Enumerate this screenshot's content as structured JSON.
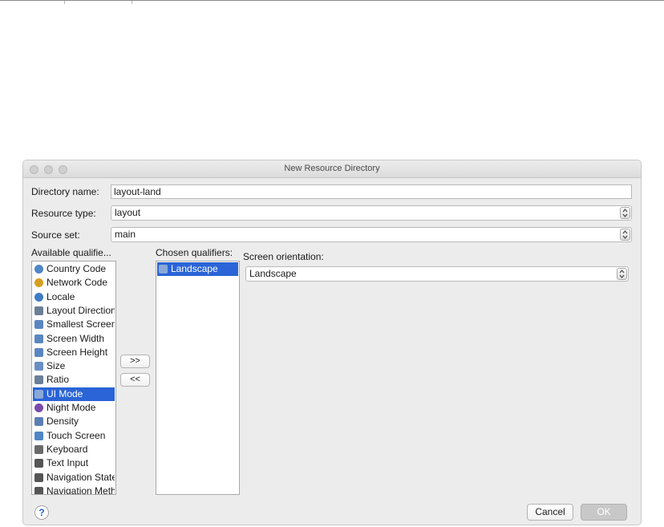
{
  "window": {
    "title": "New Resource Directory"
  },
  "form": {
    "directory_name_label": "Directory name:",
    "directory_name_value": "layout-land",
    "resource_type_label": "Resource type:",
    "resource_type_value": "layout",
    "source_set_label": "Source set:",
    "source_set_value": "main"
  },
  "available": {
    "label": "Available qualifie...",
    "items": [
      {
        "label": "Country Code",
        "icon": "globe-icon"
      },
      {
        "label": "Network Code",
        "icon": "network-icon"
      },
      {
        "label": "Locale",
        "icon": "locale-icon"
      },
      {
        "label": "Layout Direction",
        "icon": "layout-direction-icon"
      },
      {
        "label": "Smallest Screen",
        "icon": "smallest-screen-icon"
      },
      {
        "label": "Screen Width",
        "icon": "screen-width-icon"
      },
      {
        "label": "Screen Height",
        "icon": "screen-height-icon"
      },
      {
        "label": "Size",
        "icon": "size-icon"
      },
      {
        "label": "Ratio",
        "icon": "ratio-icon"
      },
      {
        "label": "UI Mode",
        "icon": "ui-mode-icon",
        "selected": true
      },
      {
        "label": "Night Mode",
        "icon": "night-mode-icon"
      },
      {
        "label": "Density",
        "icon": "density-icon"
      },
      {
        "label": "Touch Screen",
        "icon": "touch-screen-icon"
      },
      {
        "label": "Keyboard",
        "icon": "keyboard-icon"
      },
      {
        "label": "Text Input",
        "icon": "text-input-icon"
      },
      {
        "label": "Navigation State",
        "icon": "navigation-state-icon"
      },
      {
        "label": "Navigation Method",
        "icon": "navigation-method-icon"
      }
    ]
  },
  "buttons": {
    "add": ">>",
    "remove": "<<",
    "help": "?",
    "cancel": "Cancel",
    "ok": "OK"
  },
  "chosen": {
    "label": "Chosen qualifiers:",
    "items": [
      {
        "label": "Landscape",
        "icon": "landscape-icon"
      }
    ]
  },
  "orientation": {
    "label": "Screen orientation:",
    "value": "Landscape"
  },
  "colors": {
    "selection": "#2a64d6",
    "ok_button": "#c8c8c8"
  }
}
